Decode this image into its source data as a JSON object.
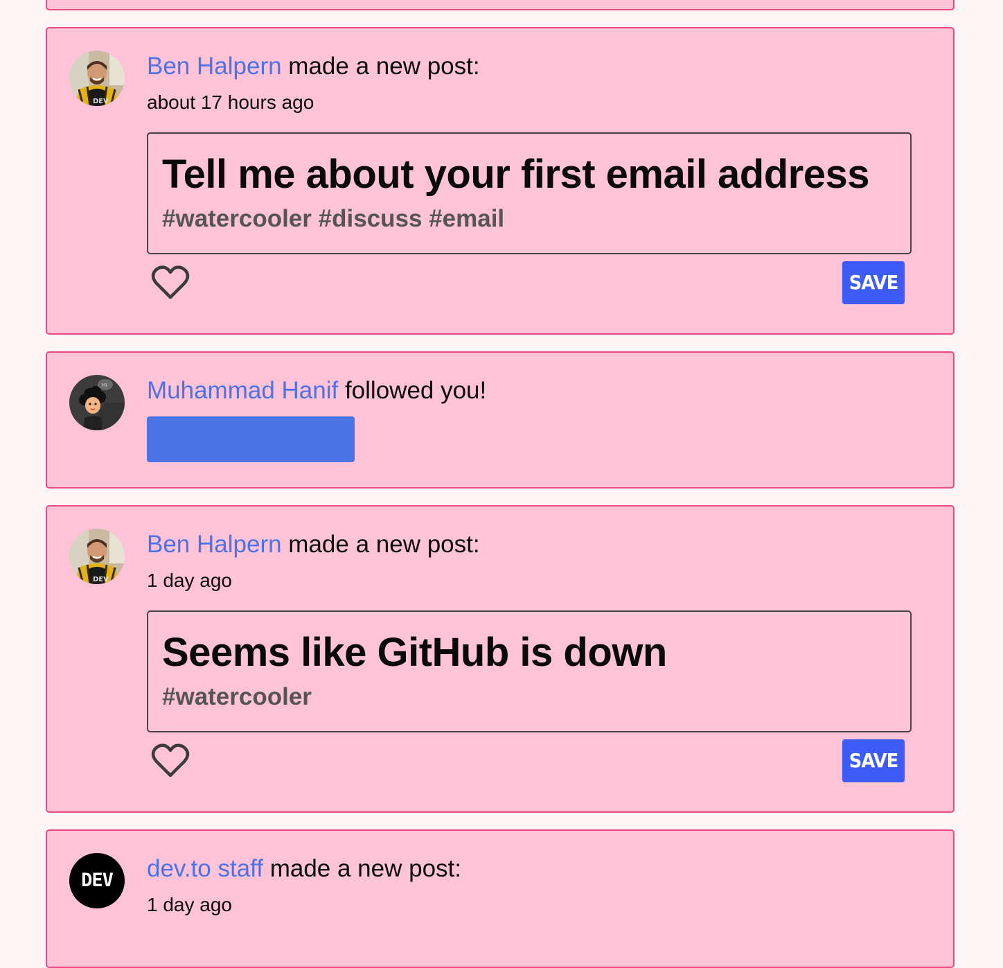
{
  "notifications": [
    {
      "author": "Ben Halpern",
      "action": " made a new post:",
      "time": "about 17 hours ago",
      "post_title": "Tell me about your first email address",
      "tags": "#watercooler #discuss #email",
      "save_label": "SAVE"
    },
    {
      "author": "Muhammad Hanif",
      "action": " followed you!",
      "follow_label": ""
    },
    {
      "author": "Ben Halpern",
      "action": " made a new post:",
      "time": "1 day ago",
      "post_title": "Seems like GitHub is down",
      "tags": "#watercooler",
      "save_label": "SAVE"
    },
    {
      "author": "dev.to staff",
      "action": " made a new post:",
      "time": "1 day ago",
      "avatar_text": "DEV"
    }
  ],
  "colors": {
    "card_bg": "#fec3d7",
    "card_border": "#e94a86",
    "author_link": "#4c72e5",
    "save_button": "#3d5cf5",
    "follow_button": "#4a74e6"
  },
  "icons": {
    "like": "heart-icon"
  }
}
